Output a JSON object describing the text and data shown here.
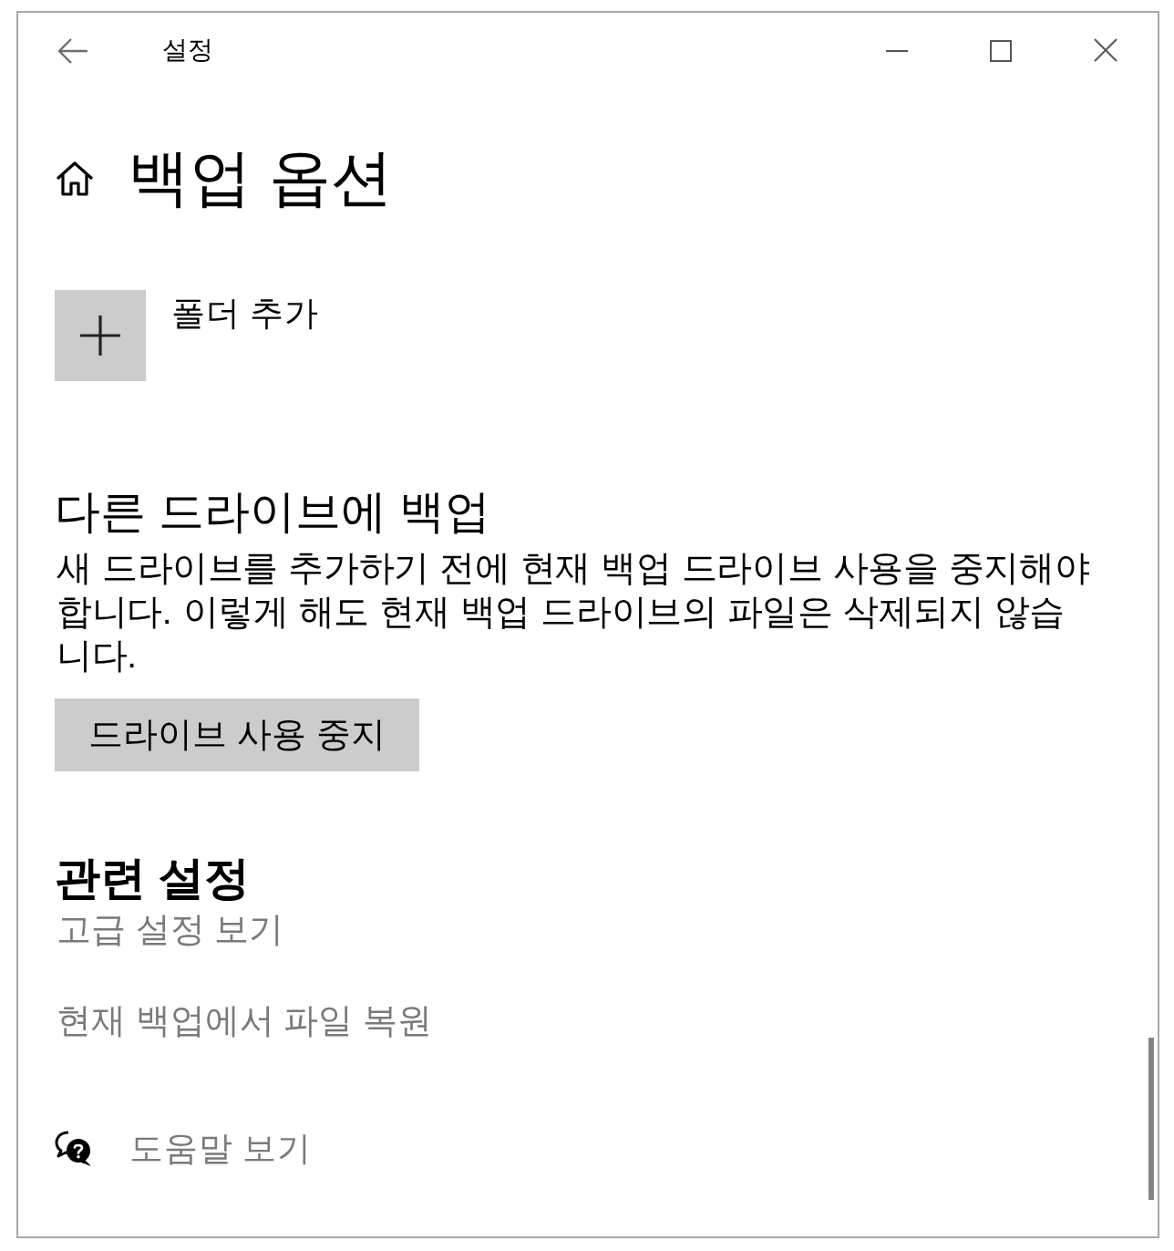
{
  "window": {
    "title": "설정"
  },
  "page": {
    "title": "백업 옵션"
  },
  "sections": [
    {
      "kind": "folders",
      "button_label": "폴더 추가"
    },
    {
      "kind": "action",
      "heading": "다른 드라이브에 백업",
      "description": "새 드라이브를 추가하기 전에 현재 백업 드라이브 사용을 중지해야 합니다. 이렇게 해도 현재 백업 드라이브의 파일은 삭제되지 않습니다.",
      "button": "드라이브 사용 중지"
    },
    {
      "kind": "links",
      "heading": "관련 설정",
      "links": [
        {
          "label": "고급 설정 보기",
          "disabled": true
        },
        {
          "label": "현재 백업에서 파일 복원",
          "disabled": true
        }
      ]
    }
  ],
  "help": {
    "label": "도움말 보기",
    "disabled": true
  }
}
